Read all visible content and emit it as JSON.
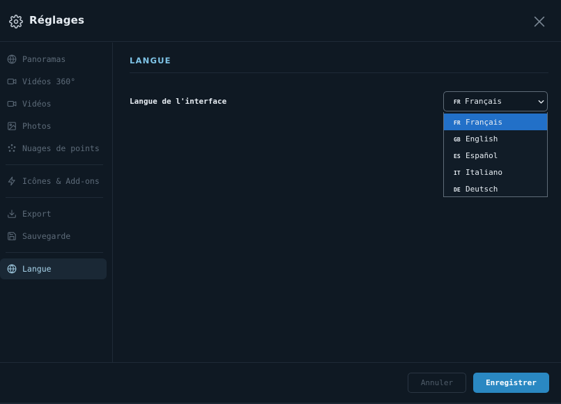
{
  "header": {
    "title": "Réglages"
  },
  "sidebar": {
    "items": [
      {
        "label": "Panoramas",
        "icon": "globe-icon"
      },
      {
        "label": "Vidéos 360°",
        "icon": "video-camera-icon"
      },
      {
        "label": "Vidéos",
        "icon": "video-camera-icon"
      },
      {
        "label": "Photos",
        "icon": "image-icon"
      },
      {
        "label": "Nuages de points",
        "icon": "point-cloud-icon"
      },
      {
        "label": "Icônes & Add-ons",
        "icon": "lightning-icon"
      },
      {
        "label": "Export",
        "icon": "download-icon"
      },
      {
        "label": "Sauvegarde",
        "icon": "save-icon"
      },
      {
        "label": "Langue",
        "icon": "globe-icon",
        "active": true
      }
    ]
  },
  "main": {
    "section_title": "LANGUE",
    "field_label": "Langue de l'interface",
    "select": {
      "code": "FR",
      "value": "Français"
    },
    "options": [
      {
        "code": "FR",
        "label": "Français",
        "selected": true
      },
      {
        "code": "GB",
        "label": "English"
      },
      {
        "code": "ES",
        "label": "Español"
      },
      {
        "code": "IT",
        "label": "Italiano"
      },
      {
        "code": "DE",
        "label": "Deutsch"
      }
    ]
  },
  "footer": {
    "cancel_label": "Annuler",
    "save_label": "Enregistrer"
  },
  "colors": {
    "accent": "#7ec3e6",
    "selected_option": "#2270c8",
    "save_button": "#2a88c2"
  }
}
